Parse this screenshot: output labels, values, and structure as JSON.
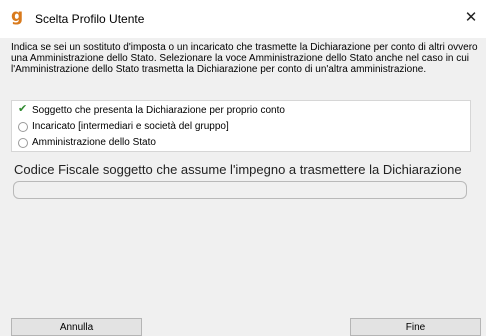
{
  "window": {
    "title": "Scelta Profilo Utente",
    "icon": "app-logo-icon",
    "close_glyph": "✕"
  },
  "info_text": "Indica se sei un sostituto d'imposta o un incaricato che trasmette la Dichiarazione per conto di altri ovvero una Amministrazione dello Stato.  Selezionare la voce Amministrazione dello Stato anche nel caso in cui l'Amministrazione dello Stato trasmetta la Dichiarazione per conto di un'altra amministrazione.",
  "profile_options": [
    {
      "label": "Soggetto che presenta la Dichiarazione per proprio conto",
      "selected": true
    },
    {
      "label": "Incaricato [intermediari e società del gruppo]",
      "selected": false
    },
    {
      "label": "Amministrazione dello Stato",
      "selected": false
    }
  ],
  "codice_fiscale": {
    "label": "Codice Fiscale soggetto che assume l'impegno a trasmettere la Dichiarazione",
    "value": ""
  },
  "buttons": {
    "cancel": "Annulla",
    "ok": "Fine"
  },
  "colors": {
    "check": "#2f8a2f",
    "app_icon": "#d97a1c"
  }
}
